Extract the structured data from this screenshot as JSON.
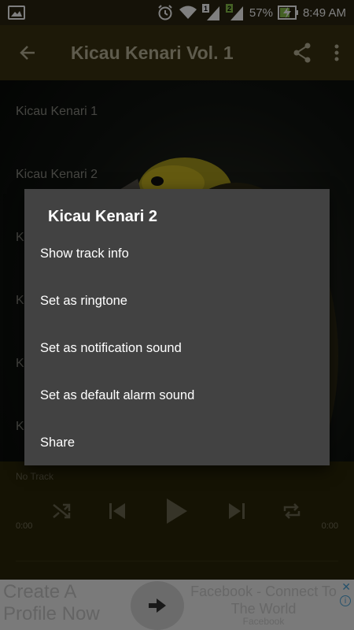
{
  "status_bar": {
    "icons": [
      "image-icon",
      "alarm-icon",
      "wifi-icon",
      "signal-sim1-icon",
      "signal-sim2-icon",
      "battery-charging-icon"
    ],
    "sim1_label": "1",
    "sim2_label": "2",
    "battery_percent": "57%",
    "time": "8:49 AM"
  },
  "app_bar": {
    "title": "Kicau Kenari Vol. 1",
    "title_color": "#bdb79a",
    "background": "#3a3210"
  },
  "track_list": {
    "items": [
      {
        "label": "Kicau Kenari 1"
      },
      {
        "label": "Kicau Kenari 2"
      },
      {
        "label": "K"
      },
      {
        "label": "K"
      },
      {
        "label": "K"
      },
      {
        "label": "K"
      }
    ]
  },
  "player": {
    "now_playing": "No Track",
    "time_elapsed": "0:00",
    "time_total": "0:00",
    "controls": [
      "shuffle-icon",
      "skip-previous-icon",
      "play-icon",
      "skip-next-icon",
      "repeat-icon"
    ]
  },
  "ad": {
    "left_text": "Create A Profile Now",
    "right_text": "Facebook - Connect To The World",
    "source": "Facebook",
    "info_icon": "i",
    "close_icon": "✕"
  },
  "dialog": {
    "title": "Kicau Kenari 2",
    "items": [
      {
        "label": "Show track info"
      },
      {
        "label": "Set as ringtone"
      },
      {
        "label": "Set as notification sound"
      },
      {
        "label": "Set as default alarm sound"
      },
      {
        "label": "Share"
      }
    ],
    "background": "#424242"
  }
}
